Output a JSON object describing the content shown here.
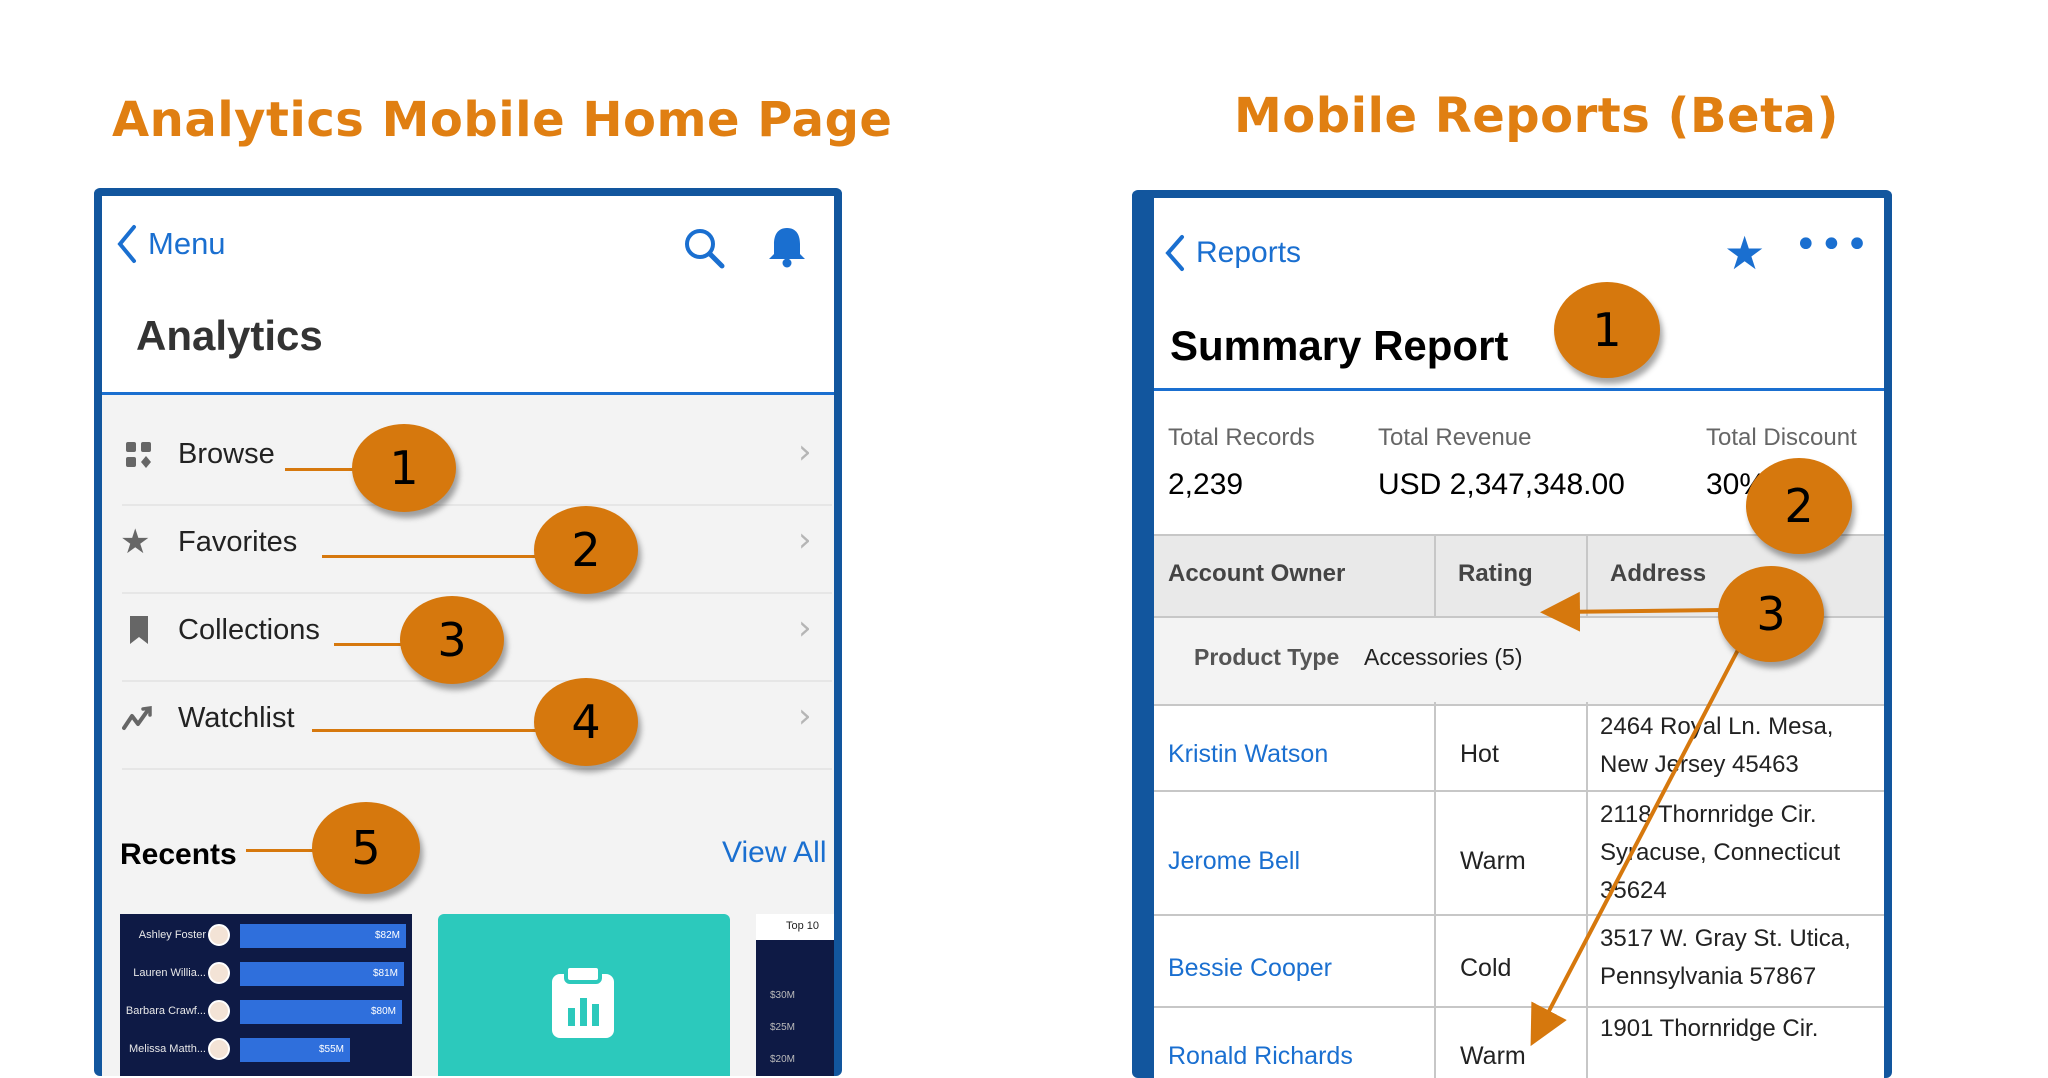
{
  "left_heading": "Analytics Mobile Home Page",
  "right_heading": "Mobile Reports (Beta)",
  "left_phone": {
    "back_label": "Menu",
    "title": "Analytics",
    "nav_items": [
      {
        "label": "Browse",
        "icon": "grid-icon"
      },
      {
        "label": "Favorites",
        "icon": "star-icon"
      },
      {
        "label": "Collections",
        "icon": "bookmark-icon"
      },
      {
        "label": "Watchlist",
        "icon": "trend-icon"
      }
    ],
    "recents_title": "Recents",
    "view_all": "View All",
    "thumb1": {
      "rows": [
        {
          "name": "Ashley Foster",
          "value": "$82M",
          "fraction": 1.0
        },
        {
          "name": "Lauren Willia...",
          "value": "$81M",
          "fraction": 0.99
        },
        {
          "name": "Barbara Crawf...",
          "value": "$80M",
          "fraction": 0.98
        },
        {
          "name": "Melissa Matth...",
          "value": "$55M",
          "fraction": 0.67
        }
      ]
    },
    "thumb3": {
      "title": "Top 10",
      "ticks": [
        "$30M",
        "$25M",
        "$20M"
      ]
    },
    "callouts": [
      "1",
      "2",
      "3",
      "4",
      "5"
    ]
  },
  "right_phone": {
    "back_label": "Reports",
    "title": "Summary Report",
    "summary": [
      {
        "label": "Total Records",
        "value": "2,239"
      },
      {
        "label": "Total Revenue",
        "value": "USD 2,347,348.00"
      },
      {
        "label": "Total Discount",
        "value": "30%"
      }
    ],
    "columns": [
      "Account Owner",
      "Rating",
      "Address"
    ],
    "group": {
      "label": "Product Type",
      "value": "Accessories (5)"
    },
    "rows": [
      {
        "owner": "Kristin Watson",
        "rating": "Hot",
        "address": [
          "2464 Royal Ln. Mesa,",
          "New Jersey 45463"
        ]
      },
      {
        "owner": "Jerome Bell",
        "rating": "Warm",
        "address": [
          "2118 Thornridge Cir.",
          "Syracuse, Connecticut",
          "35624"
        ]
      },
      {
        "owner": "Bessie Cooper",
        "rating": "Cold",
        "address": [
          "3517 W. Gray St. Utica,",
          "Pennsylvania 57867"
        ]
      },
      {
        "owner": "Ronald Richards",
        "rating": "Warm",
        "address": [
          "1901 Thornridge Cir."
        ]
      }
    ],
    "callouts": [
      "1",
      "2",
      "3"
    ]
  },
  "colors": {
    "accent": "#e07f12",
    "badge": "#d6780d",
    "link": "#1a6fd0",
    "frame": "#12569e"
  }
}
